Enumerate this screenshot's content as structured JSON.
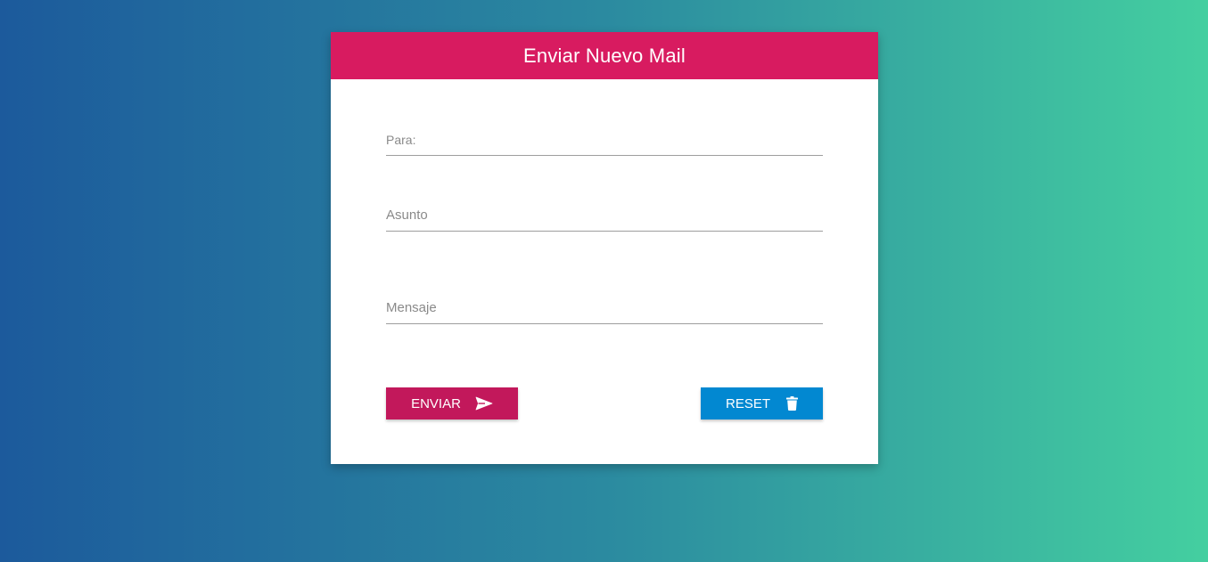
{
  "form": {
    "title": "Enviar Nuevo Mail",
    "fields": {
      "para": {
        "value": "",
        "placeholder": "Para:"
      },
      "asunto": {
        "value": "",
        "placeholder": "Asunto"
      },
      "mensaje": {
        "value": "",
        "placeholder": "Mensaje"
      }
    },
    "buttons": {
      "send": {
        "label": "ENVIAR",
        "icon": "send-icon",
        "color": "#c2185b"
      },
      "reset": {
        "label": "RESET",
        "icon": "trash-icon",
        "color": "#0288d1"
      }
    }
  },
  "colors": {
    "header": "#d81b60",
    "background_start": "#1c5a9c",
    "background_end": "#44cfa0"
  }
}
